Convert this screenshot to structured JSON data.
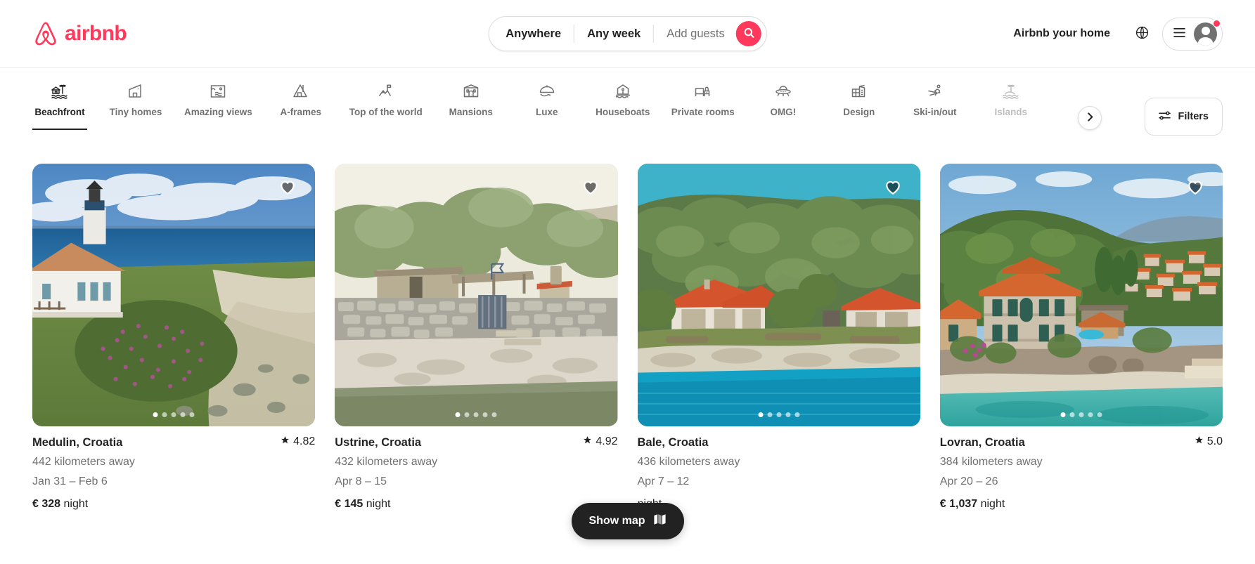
{
  "brand": {
    "name": "airbnb",
    "color": "#FF385C",
    "logo_icon": "airbnb-bel-logo"
  },
  "search": {
    "location_label": "Anywhere",
    "dates_label": "Any week",
    "guests_placeholder": "Add guests",
    "search_icon": "search-icon"
  },
  "header": {
    "host_link": "Airbnb your home",
    "globe_icon": "globe-icon",
    "menu_icon": "hamburger-menu-icon",
    "avatar_icon": "user-avatar-icon",
    "notification_badge": true
  },
  "categories": {
    "active": "Beachfront",
    "items": [
      {
        "label": "Beachfront",
        "icon": "beachfront-icon",
        "active": true,
        "faded": false
      },
      {
        "label": "Tiny homes",
        "icon": "tiny-home-icon",
        "active": false,
        "faded": false
      },
      {
        "label": "Amazing views",
        "icon": "amazing-views-icon",
        "active": false,
        "faded": false
      },
      {
        "label": "A-frames",
        "icon": "a-frame-icon",
        "active": false,
        "faded": false
      },
      {
        "label": "Top of the world",
        "icon": "mountain-flag-icon",
        "active": false,
        "faded": false
      },
      {
        "label": "Mansions",
        "icon": "mansion-icon",
        "active": false,
        "faded": false
      },
      {
        "label": "Luxe",
        "icon": "luxe-cloche-icon",
        "active": false,
        "faded": false
      },
      {
        "label": "Houseboats",
        "icon": "houseboat-icon",
        "active": false,
        "faded": false
      },
      {
        "label": "Private rooms",
        "icon": "private-room-icon",
        "active": false,
        "faded": false
      },
      {
        "label": "OMG!",
        "icon": "ufo-icon",
        "active": false,
        "faded": false
      },
      {
        "label": "Design",
        "icon": "design-building-icon",
        "active": false,
        "faded": false
      },
      {
        "label": "Ski-in/out",
        "icon": "skier-icon",
        "active": false,
        "faded": false
      },
      {
        "label": "Islands",
        "icon": "island-palm-icon",
        "active": false,
        "faded": true
      }
    ],
    "next_icon": "chevron-right-icon",
    "filters_label": "Filters",
    "filters_icon": "sliders-icon"
  },
  "listings": [
    {
      "title": "Medulin, Croatia",
      "rating": "4.82",
      "distance": "442 kilometers away",
      "dates": "Jan 31 – Feb 6",
      "price_amount": "€ 328",
      "price_unit": "night",
      "dots": 5,
      "active_dot": 0,
      "favorited": true,
      "photo_alt": "lighthouse-and-white-house-on-flowering-coastal-meadow"
    },
    {
      "title": "Ustrine, Croatia",
      "rating": "4.92",
      "distance": "432 kilometers away",
      "dates": "Apr 8 – 15",
      "price_amount": "€ 145",
      "price_unit": "night",
      "dots": 5,
      "active_dot": 0,
      "favorited": true,
      "photo_alt": "stone-wall-cottage-behind-pebble-beach-with-olive-trees"
    },
    {
      "title": "Bale, Croatia",
      "rating": "",
      "distance": "436 kilometers away",
      "dates": "Apr 7 – 12",
      "price_amount": "",
      "price_unit": "night",
      "dots": 5,
      "active_dot": 0,
      "favorited": true,
      "photo_alt": "orange-roof-villas-on-forested-shoreline-above-turquoise-sea"
    },
    {
      "title": "Lovran, Croatia",
      "rating": "5.0",
      "distance": "384 kilometers away",
      "dates": "Apr 20 – 26",
      "price_amount": "€ 1,037",
      "price_unit": "night",
      "dots": 5,
      "active_dot": 0,
      "favorited": true,
      "photo_alt": "grand-stone-villa-with-orange-roof-on-turquoise-bay"
    }
  ],
  "map_toggle": {
    "label": "Show map",
    "icon": "map-icon"
  }
}
